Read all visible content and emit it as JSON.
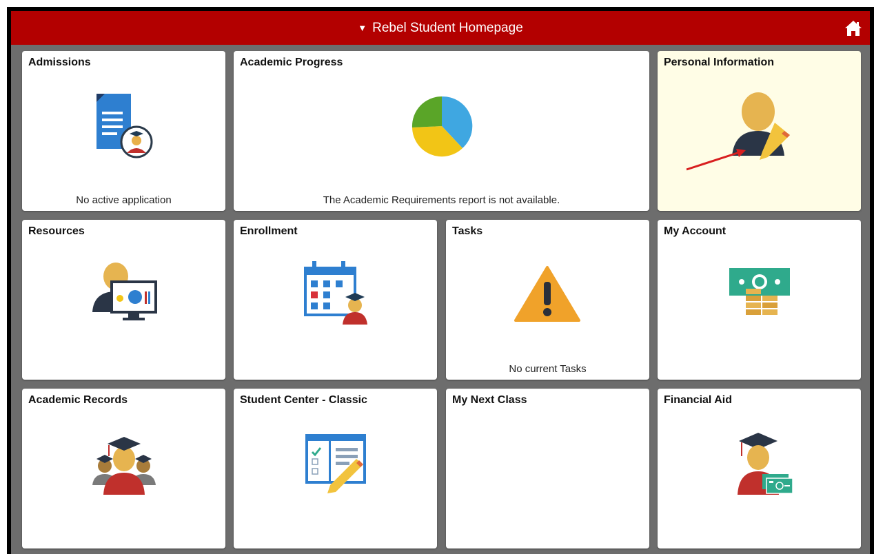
{
  "banner": {
    "title": "Rebel Student Homepage",
    "color": "#b30000"
  },
  "tiles": {
    "admissions": {
      "title": "Admissions",
      "footer": "No active application"
    },
    "academic_progress": {
      "title": "Academic Progress",
      "footer": "The Academic Requirements report is not available."
    },
    "personal_information": {
      "title": "Personal Information"
    },
    "resources": {
      "title": "Resources"
    },
    "enrollment": {
      "title": "Enrollment"
    },
    "tasks": {
      "title": "Tasks",
      "footer": "No current Tasks"
    },
    "my_account": {
      "title": "My Account"
    },
    "academic_records": {
      "title": "Academic Records"
    },
    "student_center": {
      "title": "Student Center - Classic"
    },
    "my_next_class": {
      "title": "My Next Class"
    },
    "financial_aid": {
      "title": "Financial Aid"
    }
  },
  "icons": {
    "admissions": "document-graduate-icon",
    "academic_progress": "pie-chart-icon",
    "personal_information": "person-edit-icon",
    "resources": "person-monitor-icon",
    "enrollment": "calendar-graduate-icon",
    "tasks": "warning-icon",
    "my_account": "money-coins-icon",
    "academic_records": "graduates-group-icon",
    "student_center": "checklist-pencil-icon",
    "financial_aid": "graduate-money-icon",
    "home": "home-icon"
  }
}
